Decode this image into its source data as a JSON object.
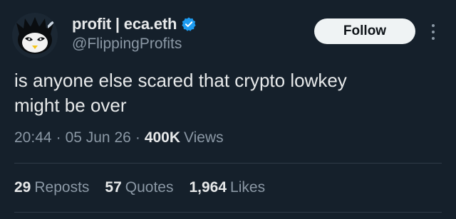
{
  "author": {
    "display_name": "profit | eca.eth",
    "handle": "@FlippingProfits",
    "avatar_icon": "avatar-character-icon",
    "verified_icon": "verified-badge-icon",
    "verified_color": "#1d9bf0"
  },
  "follow_button": {
    "label": "Follow"
  },
  "more_icon": "more-vertical-icon",
  "tweet": {
    "text": "is anyone else scared that crypto lowkey\nmight be over"
  },
  "meta": {
    "time": "20:44",
    "separator": "·",
    "date": "05 Jun 26",
    "views_count": "400K",
    "views_label": "Views"
  },
  "stats": {
    "reposts_count": "29",
    "reposts_label": "Reposts",
    "quotes_count": "57",
    "quotes_label": "Quotes",
    "likes_count": "1,964",
    "likes_label": "Likes"
  },
  "colors": {
    "background": "#15202b",
    "primary_text": "#e7e9ea",
    "secondary_text": "#8b98a5",
    "button_bg": "#eff3f4"
  }
}
